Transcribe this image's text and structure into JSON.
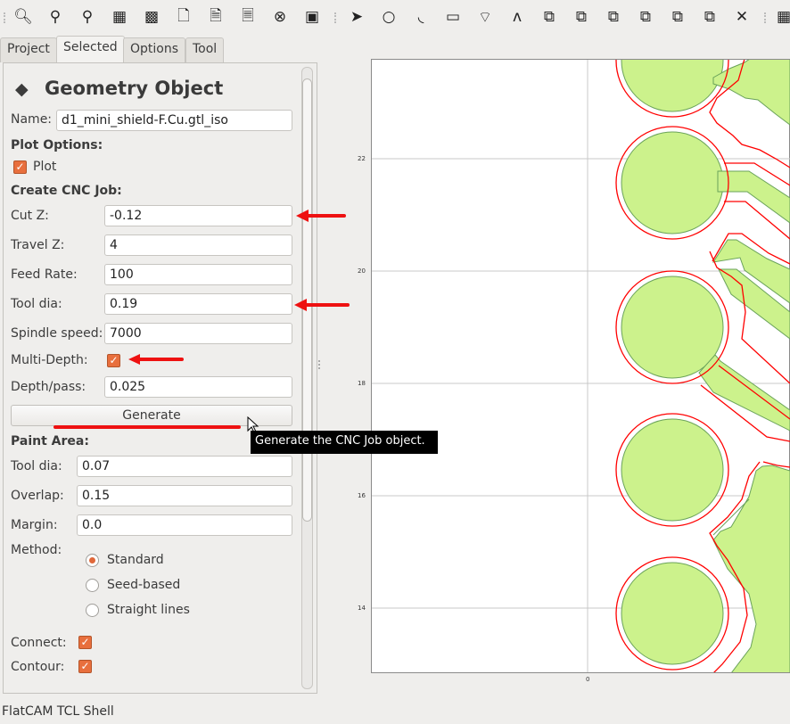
{
  "toolbar": {
    "icons": [
      "zoom-fit-icon",
      "zoom-out-icon",
      "zoom-in-icon",
      "clear-plot-icon",
      "replot-icon",
      "new-file-icon",
      "open-file-icon",
      "ok-icon",
      "delete-icon",
      "shell-icon",
      "pointer-icon",
      "circle-icon",
      "arc-icon",
      "rectangle-icon",
      "polygon-icon",
      "path-icon",
      "union-icon",
      "intersection-icon",
      "subtract-icon",
      "cut-icon",
      "move-icon",
      "copy-icon",
      "delete-shape-icon",
      "grid-icon"
    ]
  },
  "tabs": [
    {
      "label": "Project"
    },
    {
      "label": "Selected"
    },
    {
      "label": "Options"
    },
    {
      "label": "Tool"
    }
  ],
  "panel": {
    "title": "Geometry Object",
    "name_label": "Name:",
    "name_value": "d1_mini_shield-F.Cu.gtl_iso",
    "plot_options": "Plot Options:",
    "plot_label": "Plot",
    "plot_checked": true,
    "cnc_header": "Create CNC Job:",
    "cut_z_label": "Cut Z:",
    "cut_z": "-0.12",
    "travel_z_label": "Travel Z:",
    "travel_z": "4",
    "feed_label": "Feed Rate:",
    "feed": "100",
    "tooldia_label": "Tool dia:",
    "tooldia": "0.19",
    "spindle_label": "Spindle speed:",
    "spindle": "7000",
    "multidepth_label": "Multi-Depth:",
    "multidepth_checked": true,
    "depth_label": "Depth/pass:",
    "depth": "0.025",
    "generate": "Generate",
    "paint_header": "Paint Area:",
    "paint_tooldia_label": "Tool dia:",
    "paint_tooldia": "0.07",
    "overlap_label": "Overlap:",
    "overlap": "0.15",
    "margin_label": "Margin:",
    "margin": "0.0",
    "method_label": "Method:",
    "methods": [
      "Standard",
      "Seed-based",
      "Straight lines"
    ],
    "method_selected": "Standard",
    "connect_label": "Connect:",
    "connect_checked": true,
    "contour_label": "Contour:",
    "contour_checked": true
  },
  "tooltip": "Generate the CNC Job object.",
  "plot": {
    "y_ticks": [
      "22",
      "20",
      "18",
      "16",
      "14"
    ],
    "x_ticks": [
      "0"
    ],
    "copper_color": "#ccf28c",
    "iso_color": "#ff0000"
  },
  "annotation_color": "#ee1111",
  "status": "FlatCAM TCL Shell"
}
